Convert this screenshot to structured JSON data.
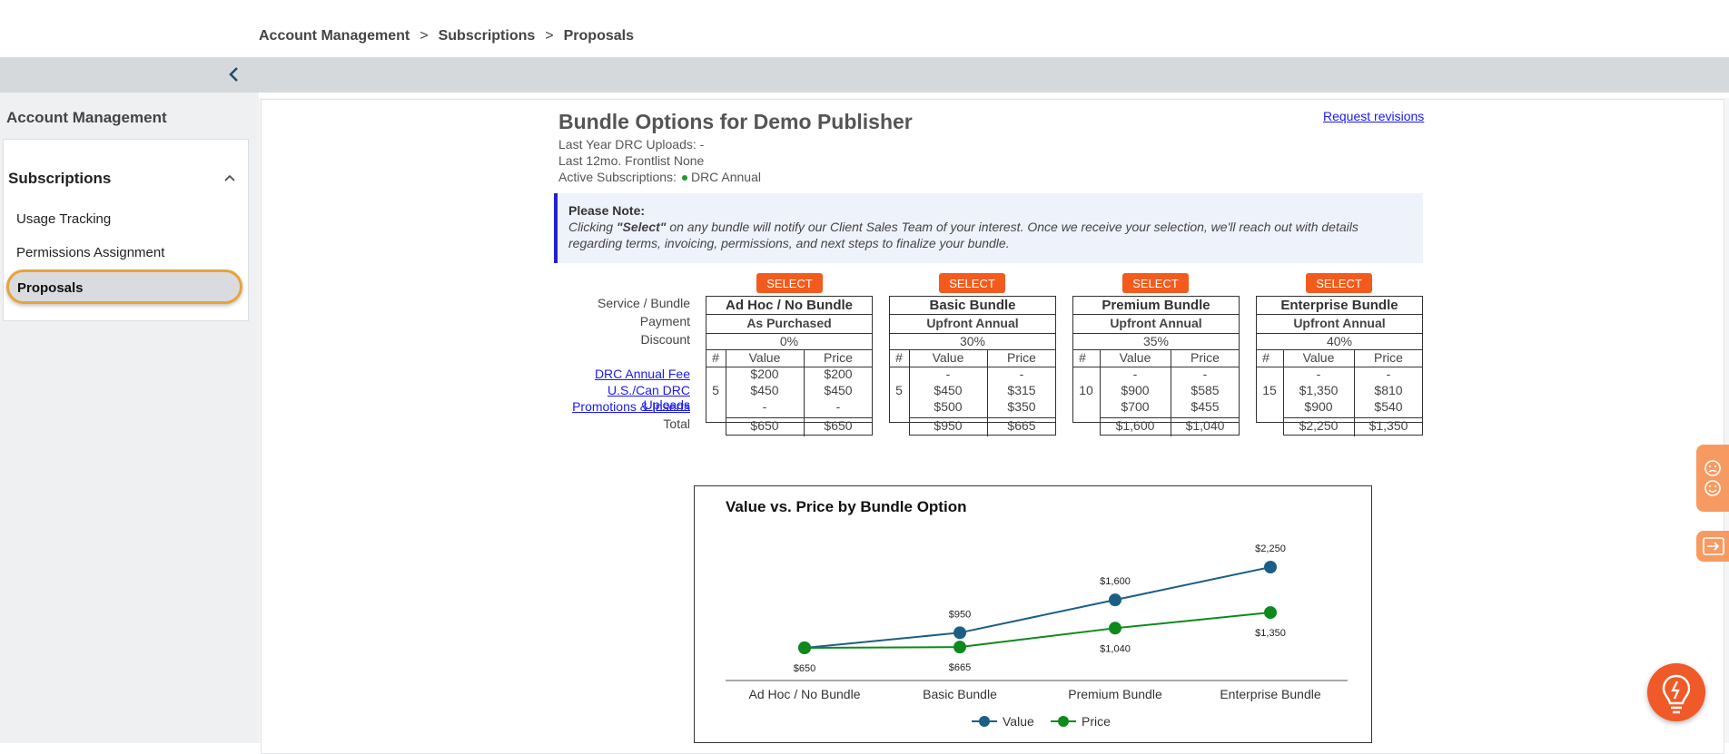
{
  "breadcrumb": {
    "items": [
      "Account Management",
      "Subscriptions",
      "Proposals"
    ],
    "sep": ">"
  },
  "sidebar": {
    "title": "Account Management",
    "section": "Subscriptions",
    "items": [
      "Usage Tracking",
      "Permissions Assignment",
      "Proposals"
    ],
    "active": "Proposals"
  },
  "main": {
    "title": "Bundle Options for Demo Publisher",
    "request_link": "Request revisions",
    "last_year": "Last Year DRC Uploads: -",
    "last_12mo": "Last 12mo. Frontlist None",
    "active_label": "Active Subscriptions:",
    "active_value": "DRC Annual",
    "note_title": "Please Note:",
    "note_pre": "Clicking ",
    "note_select": "\"Select\"",
    "note_body": " on any bundle will notify our Client Sales Team of your interest. Once we receive your selection, we'll reach out with details regarding terms, invoicing, permissions, and next steps to finalize your bundle."
  },
  "row_labels": {
    "service": "Service / Bundle",
    "payment": "Payment",
    "discount": "Discount",
    "fee": "DRC Annual Fee",
    "uploads": "U.S./Can DRC Uploads",
    "promos": "Promotions & Inserts",
    "total": "Total"
  },
  "col_headers": {
    "num": "#",
    "value": "Value",
    "price": "Price"
  },
  "select_label": "SELECT",
  "bundles": [
    {
      "name": "Ad Hoc / No Bundle",
      "payment": "As Purchased",
      "discount": "0%",
      "count": "5",
      "fee": [
        "$200",
        "$200"
      ],
      "uploads": [
        "$450",
        "$450"
      ],
      "promos": [
        "-",
        "-"
      ],
      "total": [
        "$650",
        "$650"
      ]
    },
    {
      "name": "Basic Bundle",
      "payment": "Upfront Annual",
      "discount": "30%",
      "count": "5",
      "fee": [
        "-",
        "-"
      ],
      "uploads": [
        "$450",
        "$315"
      ],
      "promos": [
        "$500",
        "$350"
      ],
      "total": [
        "$950",
        "$665"
      ]
    },
    {
      "name": "Premium Bundle",
      "payment": "Upfront Annual",
      "discount": "35%",
      "count": "10",
      "fee": [
        "-",
        "-"
      ],
      "uploads": [
        "$900",
        "$585"
      ],
      "promos": [
        "$700",
        "$455"
      ],
      "total": [
        "$1,600",
        "$1,040"
      ]
    },
    {
      "name": "Enterprise Bundle",
      "payment": "Upfront Annual",
      "discount": "40%",
      "count": "15",
      "fee": [
        "-",
        "-"
      ],
      "uploads": [
        "$1,350",
        "$810"
      ],
      "promos": [
        "$900",
        "$540"
      ],
      "total": [
        "$2,250",
        "$1,350"
      ]
    }
  ],
  "chart_data": {
    "type": "line",
    "title": "Value vs. Price by Bundle Option",
    "categories": [
      "Ad Hoc / No Bundle",
      "Basic Bundle",
      "Premium Bundle",
      "Enterprise Bundle"
    ],
    "series": [
      {
        "name": "Value",
        "values": [
          650,
          950,
          1600,
          2250
        ],
        "labels": [
          "$650",
          "$950",
          "$1,600",
          "$2,250"
        ],
        "color": "#1b5e86"
      },
      {
        "name": "Price",
        "values": [
          650,
          665,
          1040,
          1350
        ],
        "labels": [
          "$650",
          "$665",
          "$1,040",
          "$1,350"
        ],
        "color": "#0c8a1c"
      }
    ],
    "legend": "bottom-center",
    "grid": false
  },
  "colors": {
    "accent": "#f25b1d",
    "link": "#1a1aee",
    "highlight": "#e8a33a"
  },
  "icons": {
    "collapse": "chevron-left-icon",
    "section_toggle": "chevron-up-icon",
    "feedback": "smiley-face-icon",
    "exit": "logout-icon",
    "help": "lightbulb-icon"
  }
}
